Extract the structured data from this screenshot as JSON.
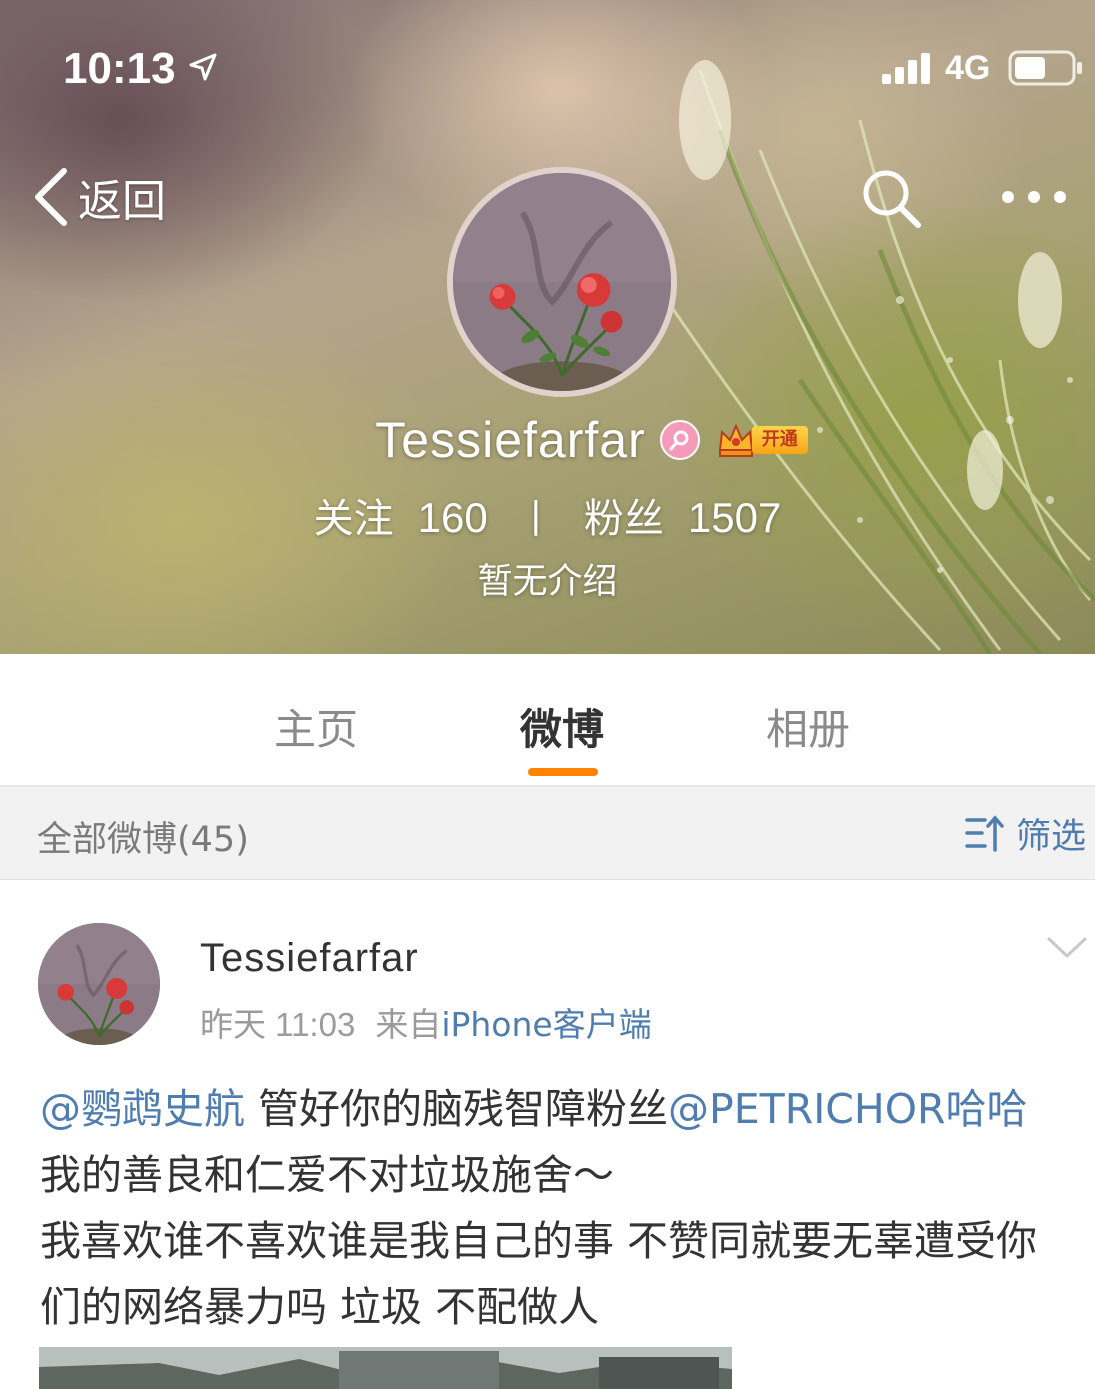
{
  "status_bar": {
    "time": "10:13",
    "network": "4G",
    "icons": [
      "location-arrow-icon",
      "signal-bars-icon",
      "battery-icon"
    ]
  },
  "nav": {
    "back_label": "返回",
    "icons": [
      "back-chevron-icon",
      "search-icon",
      "more-dots-icon"
    ]
  },
  "profile": {
    "name": "Tessiefarfar",
    "vip_tag": "开通",
    "following_label": "关注",
    "following_count": "160",
    "stats_divider": "|",
    "followers_label": "粉丝",
    "followers_count": "1507",
    "bio": "暂无介绍"
  },
  "tabs": [
    {
      "label": "主页",
      "active": false
    },
    {
      "label": "微博",
      "active": true
    },
    {
      "label": "相册",
      "active": false
    }
  ],
  "filter_bar": {
    "title": "全部微博(45)",
    "filter_label": "筛选"
  },
  "post": {
    "author": "Tessiefarfar",
    "time": "昨天 11:03",
    "source_prefix": "来自",
    "source": "iPhone客户端",
    "mention_1": "@鹦鹉史航",
    "text_1": " 管好你的脑残智障粉丝",
    "mention_2": "@PETRICHOR哈哈",
    "text_2": " 我的善良和仁爱不对垃圾施舍～",
    "text_3": "我喜欢谁不喜欢谁是我自己的事 不赞同就要无辜遭受你们的网络暴力吗 垃圾 不配做人"
  },
  "colors": {
    "accent_orange": "#ff8200",
    "link_blue": "#507daf",
    "text_dark": "#333333",
    "text_gray": "#9b9b9b"
  }
}
